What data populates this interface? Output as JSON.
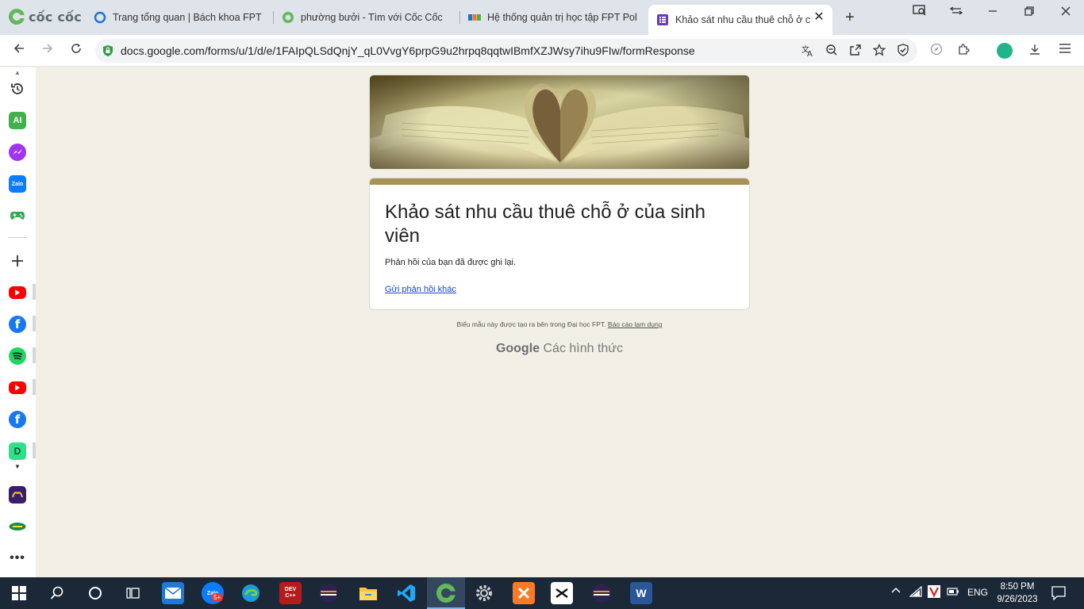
{
  "browser": {
    "brand": "cốc cốc",
    "tabs": [
      {
        "label": "Trang tổng quan | Bách khoa FPT | Tr"
      },
      {
        "label": "phường bưởi - Tìm với Cốc Cốc"
      },
      {
        "label": "Hệ thống quản trị học tập FPT Polyte"
      },
      {
        "label": "Khảo sát nhu cầu thuê chỗ ở của"
      }
    ],
    "url": "docs.google.com/forms/u/1/d/e/1FAIpQLSdQnjY_qL0VvgY6prpG9u2hrpq8qqtwIBmfXZJWsy7ihu9FIw/formResponse"
  },
  "form": {
    "title": "Khảo sát nhu cầu thuê chỗ ở của sinh viên",
    "message": "Phản hồi của bạn đã được ghi lại.",
    "link": "Gửi phản hồi khác",
    "footer_text": "Biểu mẫu này được tạo ra bên trong Đại học FPT.",
    "footer_link": "Báo cáo lạm dụng",
    "brand_google": "Google",
    "brand_forms": "Các hình thức"
  },
  "sidebar": {
    "ai_label": "AI",
    "zalo_label": "Zalo",
    "d_label": "D"
  },
  "taskbar": {
    "zalo_badge": "5+",
    "devcpp_label": "DEV C++",
    "word_label": "W",
    "language": "ENG",
    "time": "8:50 PM",
    "date": "9/26/2023"
  },
  "colors": {
    "accent": "#a8925a",
    "page_bg": "#f1efe6",
    "link": "#1a47c8",
    "taskbar": "#1b2838"
  }
}
